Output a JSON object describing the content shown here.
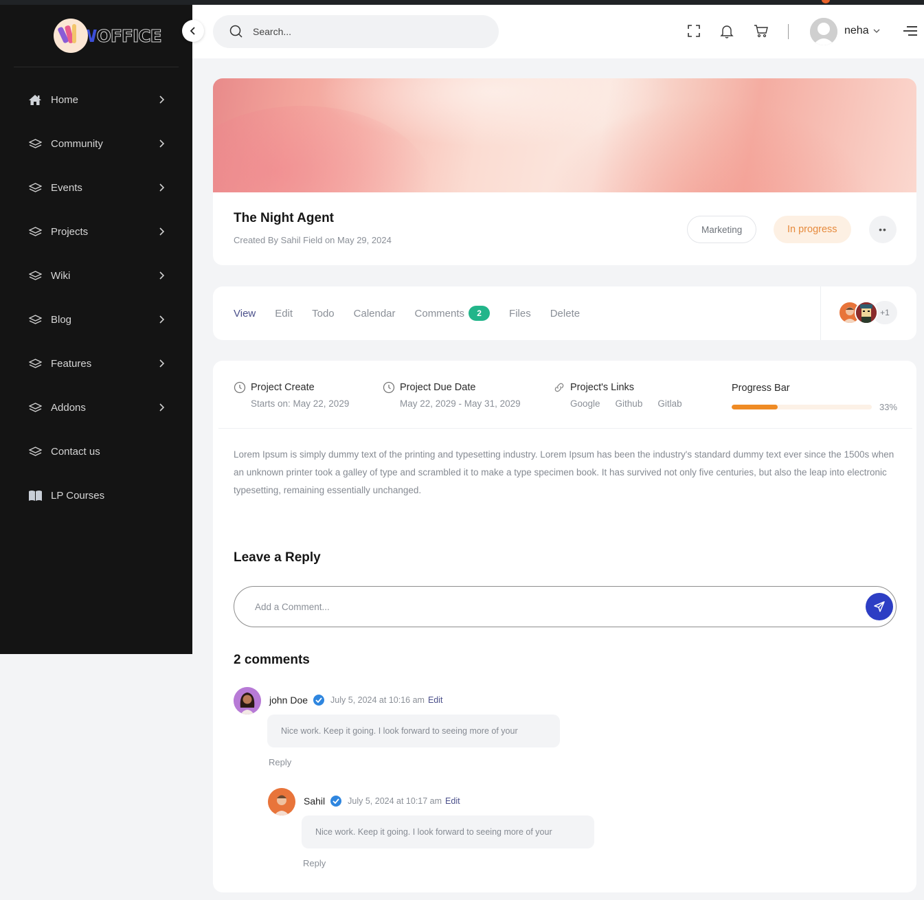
{
  "brand": {
    "logo_text_first": "W",
    "logo_text_rest": "OFFICE"
  },
  "sidebar": {
    "items": [
      {
        "label": "Home",
        "icon": "home-icon"
      },
      {
        "label": "Community",
        "icon": "layers-icon"
      },
      {
        "label": "Events",
        "icon": "layers-icon"
      },
      {
        "label": "Projects",
        "icon": "layers-icon"
      },
      {
        "label": "Wiki",
        "icon": "layers-icon"
      },
      {
        "label": "Blog",
        "icon": "layers-icon"
      },
      {
        "label": "Features",
        "icon": "layers-icon"
      },
      {
        "label": "Addons",
        "icon": "layers-icon"
      },
      {
        "label": "Contact us",
        "icon": "layers-icon"
      },
      {
        "label": "LP Courses",
        "icon": "book-icon"
      }
    ]
  },
  "header": {
    "search_placeholder": "Search...",
    "user_name": "neha"
  },
  "project": {
    "title": "The Night Agent",
    "created_by": "Created By Sahil Field on May 29, 2024",
    "category_tag": "Marketing",
    "status": "In progress",
    "more_label": "••"
  },
  "tabs": {
    "items": [
      {
        "label": "View",
        "active": true
      },
      {
        "label": "Edit"
      },
      {
        "label": "Todo"
      },
      {
        "label": "Calendar"
      },
      {
        "label": "Comments",
        "badge": "2"
      },
      {
        "label": "Files"
      },
      {
        "label": "Delete"
      }
    ],
    "members_more": "+1"
  },
  "details": {
    "create": {
      "label": "Project Create",
      "value": "Starts on: May 22, 2029"
    },
    "due": {
      "label": "Project Due Date",
      "value": "May 22, 2029 - May 31, 2029"
    },
    "links": {
      "label": "Project's Links",
      "items": [
        "Google",
        "Github",
        "Gitlab"
      ]
    },
    "progress": {
      "label": "Progress Bar",
      "percent": 33,
      "percent_text": "33%"
    },
    "description": "Lorem Ipsum is simply dummy text of the printing and typesetting industry. Lorem Ipsum has been the industry's standard dummy text ever since the 1500s  when an unknown printer took a galley of type and scrambled it to make a type specimen book. It has survived not only five centuries, but also the leap into  electronic typesetting, remaining essentially unchanged."
  },
  "reply": {
    "title": "Leave a Reply",
    "placeholder": "Add a Comment..."
  },
  "comments": {
    "count_label": "2 comments",
    "items": [
      {
        "author": "john Doe",
        "date": "July 5, 2024 at 10:16 am",
        "edit_label": "Edit",
        "text": "Nice work. Keep it going. I look forward to seeing more of your",
        "reply_label": "Reply",
        "avatar_color": "#b77ad6"
      },
      {
        "author": "Sahil",
        "date": "July 5, 2024 at 10:17 am",
        "edit_label": "Edit",
        "text": "Nice work. Keep it going. I look forward to seeing more of your",
        "reply_label": "Reply",
        "avatar_color": "#e8743a"
      }
    ]
  },
  "colors": {
    "accent_blue": "#2d3ec4",
    "badge_green": "#22b58a",
    "status_orange": "#e68a3c",
    "progress_orange": "#ef8b24",
    "sidebar_bg": "#141414"
  }
}
